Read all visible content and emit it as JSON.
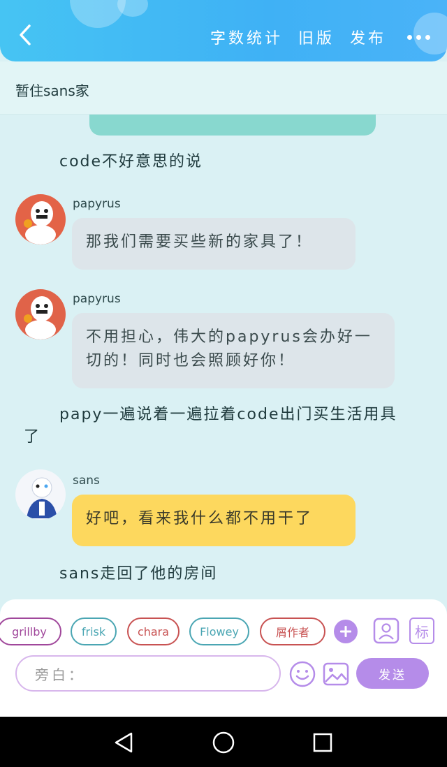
{
  "header": {
    "actions": [
      "字数统计",
      "旧版",
      "发布"
    ],
    "bg_color": "#46c4f3"
  },
  "subheader": {
    "title": "暂住sans家"
  },
  "chat": {
    "narration_1": "code不好意思的说",
    "messages": [
      {
        "name": "papyrus",
        "text": "那我们需要买些新的家具了！"
      },
      {
        "name": "papyrus",
        "text_lines": [
          "不用担心，伟大的papyrus会办好一",
          "切的！同时也会照顾好你！"
        ]
      }
    ],
    "narration_2_lines": [
      "papy一遍说着一遍拉着code出门买生活用具",
      "了"
    ],
    "sans_message": {
      "name": "sans",
      "text": "好吧，看来我什么都不用干了"
    },
    "narration_3": "sans走回了他的房间"
  },
  "panel": {
    "chips": [
      "grillby",
      "frisk",
      "chara",
      "Flowey",
      "屑作者"
    ],
    "tag_label": "标",
    "input_placeholder": "旁白：",
    "send_label": "发送"
  },
  "colors": {
    "chip_magenta": "#a0479b",
    "chip_teal": "#4aa6b3",
    "chip_red": "#c85252",
    "accent_purple": "#b58ce9",
    "bubble_yellow": "#fdd85e",
    "bubble_gray": "#dde5ea"
  }
}
